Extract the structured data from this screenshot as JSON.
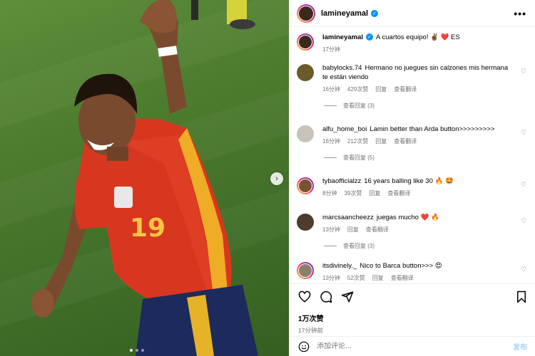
{
  "post": {
    "author": "lamineyamal",
    "caption": "A cuartos equipo! ✌🏾 ❤️ ES",
    "caption_time": "17分钟",
    "likes": "1万次赞",
    "time_ago": "17分钟前",
    "jersey_number": "19"
  },
  "header": {
    "username": "lamineyamal",
    "more_label": "•••"
  },
  "comments": [
    {
      "user": "babylocks.74",
      "text": "Hermano no juegues sin calzones mis hermana te están viendo",
      "time": "16分钟",
      "likes": "429次赞",
      "reply": "回复",
      "translate": "查看翻译",
      "view_replies": "查看回复 (3)",
      "avatar_color": "#6a5a2c"
    },
    {
      "user": "alfu_home_boi",
      "text": "Lamin better than Arda button>>>>>>>>>",
      "time": "16分钟",
      "likes": "212次赞",
      "reply": "回复",
      "translate": "查看翻译",
      "view_replies": "查看回复 (5)",
      "avatar_color": "#c9c2b8"
    },
    {
      "user": "tybaofficialzz",
      "text": "16 years balling like 30 🔥 🤩",
      "time": "8分钟",
      "likes": "39次赞",
      "reply": "回复",
      "translate": "查看翻译",
      "avatar_color": "#7a5230"
    },
    {
      "user": "marcsaancheezz",
      "text": "juegas mucho ❤️ 🔥",
      "time": "13分钟",
      "reply": "回复",
      "translate": "查看翻译",
      "view_replies": "查看回复 (3)",
      "avatar_color": "#4d3b2d"
    },
    {
      "user": "itsdivinely._",
      "text": "Nico to Barca button>>> 😍",
      "time": "13分钟",
      "likes": "52次赞",
      "reply": "回复",
      "translate": "查看翻译",
      "avatar_color": "#8a7f6a"
    }
  ],
  "composer": {
    "placeholder": "添加评论...",
    "post_label": "发布"
  },
  "colors": {
    "accent": "#0095f6",
    "meta": "#737373",
    "jersey": "#d8371f",
    "shorts": "#1d2a5c",
    "pitch": "#4d7c2e"
  }
}
